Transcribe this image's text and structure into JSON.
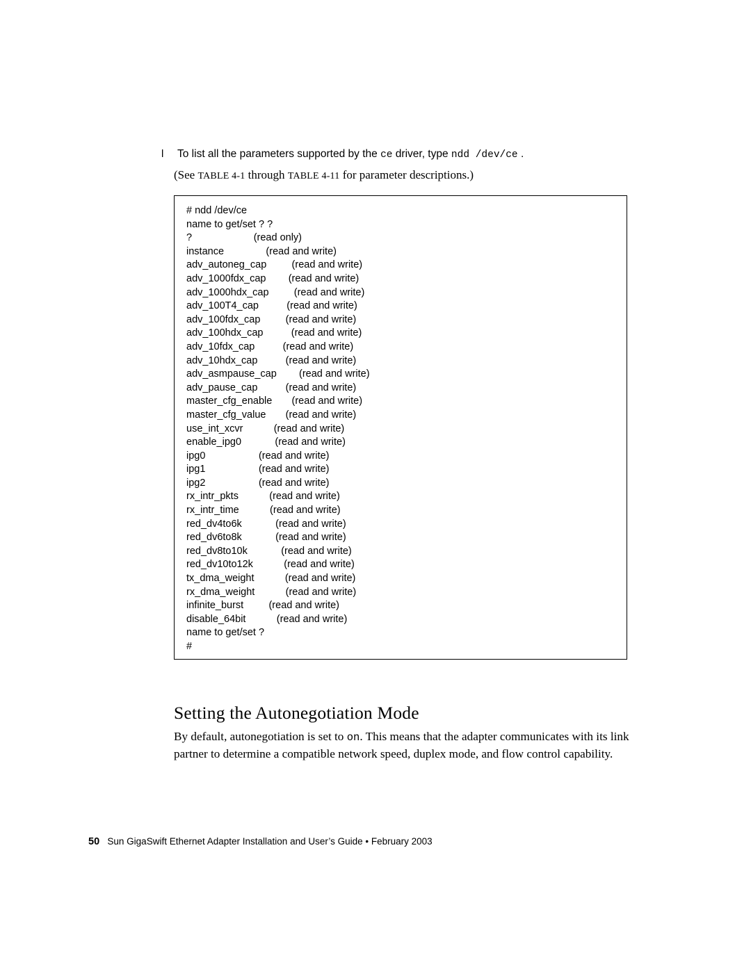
{
  "step": {
    "bullet": "l",
    "text_before": "To list all the parameters supported by the ",
    "mono_1": "ce",
    "text_mid": " driver, type ",
    "mono_2": "ndd /dev/ce",
    "text_after": " ."
  },
  "see_line": {
    "prefix": "(See ",
    "table_a": "TABLE 4-1",
    "mid": " through ",
    "table_b": "TABLE 4-11",
    "suffix": " for parameter descriptions.)"
  },
  "code_block": {
    "lines": [
      "# ndd /dev/ce",
      "name to get/set ? ?",
      "?                      (read only)",
      "instance               (read and write)",
      "adv_autoneg_cap         (read and write)",
      "adv_1000fdx_cap        (read and write)",
      "adv_1000hdx_cap         (read and write)",
      "adv_100T4_cap          (read and write)",
      "adv_100fdx_cap         (read and write)",
      "adv_100hdx_cap          (read and write)",
      "adv_10fdx_cap          (read and write)",
      "adv_10hdx_cap          (read and write)",
      "adv_asmpause_cap        (read and write)",
      "adv_pause_cap          (read and write)",
      "master_cfg_enable       (read and write)",
      "master_cfg_value       (read and write)",
      "use_int_xcvr           (read and write)",
      "enable_ipg0            (read and write)",
      "ipg0                   (read and write)",
      "ipg1                   (read and write)",
      "ipg2                   (read and write)",
      "rx_intr_pkts           (read and write)",
      "rx_intr_time           (read and write)",
      "red_dv4to6k            (read and write)",
      "red_dv6to8k            (read and write)",
      "red_dv8to10k            (read and write)",
      "red_dv10to12k           (read and write)",
      "tx_dma_weight           (read and write)",
      "rx_dma_weight           (read and write)",
      "infinite_burst         (read and write)",
      "disable_64bit           (read and write)",
      "name to get/set ?",
      "#"
    ]
  },
  "heading": "Setting the Autonegotiation Mode",
  "paragraph": {
    "part1": "By default, autonegotiation is set to ",
    "mono": "on",
    "part2": ". This means that the adapter communicates with its link partner to determine a compatible network speed, duplex mode, and flow control capability."
  },
  "footer": {
    "page_number": "50",
    "text": "Sun GigaSwift Ethernet Adapter Installation and User’s Guide • February 2003"
  }
}
